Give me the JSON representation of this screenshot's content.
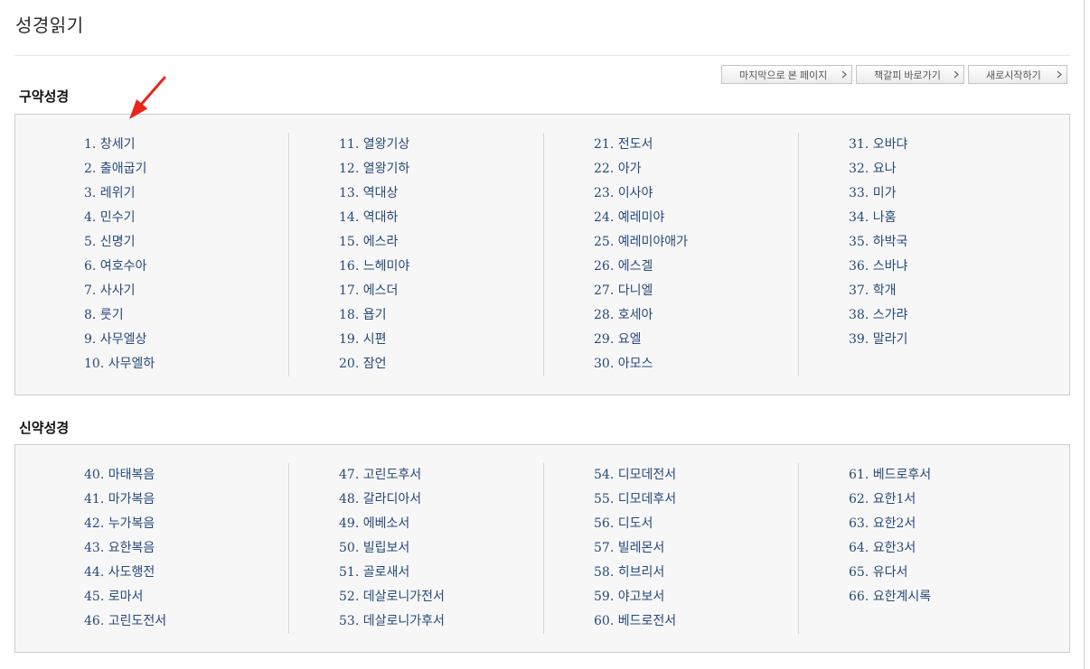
{
  "page": {
    "title": "성경읽기"
  },
  "toolbar": {
    "buttons": [
      {
        "label": "마지막으로 본 페이지",
        "icon": "chevron-right-icon"
      },
      {
        "label": "책갈피 바로가기",
        "icon": "chevron-right-icon"
      },
      {
        "label": "새로시작하기",
        "icon": "chevron-right-icon"
      }
    ]
  },
  "annotation": {
    "icon": "red-arrow-icon"
  },
  "colors": {
    "link": "#26497a",
    "box_background": "#f7f7f7",
    "box_border": "#cdcdcd",
    "annotation_arrow": "#e8261c"
  },
  "sections": [
    {
      "heading": "구약성경",
      "columns": [
        [
          "1. 창세기",
          "2. 출애굽기",
          "3. 레위기",
          "4. 민수기",
          "5. 신명기",
          "6. 여호수아",
          "7. 사사기",
          "8. 룻기",
          "9. 사무엘상",
          "10. 사무엘하"
        ],
        [
          "11. 열왕기상",
          "12. 열왕기하",
          "13. 역대상",
          "14. 역대하",
          "15. 에스라",
          "16. 느헤미야",
          "17. 에스더",
          "18. 욥기",
          "19. 시편",
          "20. 잠언"
        ],
        [
          "21. 전도서",
          "22. 아가",
          "23. 이사야",
          "24. 예레미야",
          "25. 예레미야애가",
          "26. 에스겔",
          "27. 다니엘",
          "28. 호세아",
          "29. 요엘",
          "30. 아모스"
        ],
        [
          "31. 오바댜",
          "32. 요나",
          "33. 미가",
          "34. 나훔",
          "35. 하박국",
          "36. 스바냐",
          "37. 학개",
          "38. 스가랴",
          "39. 말라기"
        ]
      ]
    },
    {
      "heading": "신약성경",
      "columns": [
        [
          "40. 마태복음",
          "41. 마가복음",
          "42. 누가복음",
          "43. 요한복음",
          "44. 사도행전",
          "45. 로마서",
          "46. 고린도전서"
        ],
        [
          "47. 고린도후서",
          "48. 갈라디아서",
          "49. 에베소서",
          "50. 빌립보서",
          "51. 골로새서",
          "52. 데살로니가전서",
          "53. 데살로니가후서"
        ],
        [
          "54. 디모데전서",
          "55. 디모데후서",
          "56. 디도서",
          "57. 빌레몬서",
          "58. 히브리서",
          "59. 야고보서",
          "60. 베드로전서"
        ],
        [
          "61. 베드로후서",
          "62. 요한1서",
          "63. 요한2서",
          "64. 요한3서",
          "65. 유다서",
          "66. 요한계시록"
        ]
      ]
    }
  ]
}
